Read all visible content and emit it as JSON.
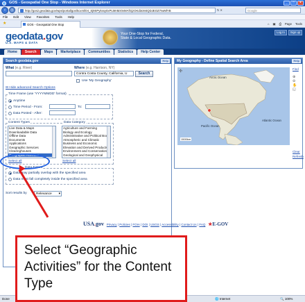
{
  "window": {
    "title": "GOS - Geospatial One Stop - Windows Internet Explorer"
  },
  "browser": {
    "url": "http://gos2.geodata.gov/wps/portal/gos/kcxml/04_Sj9SPykssy0xPLMnMz0vMAfGjzOKd3cM4QDJEOZ7IwMlYB",
    "search_placeholder": "Google",
    "menu": [
      "File",
      "Edit",
      "View",
      "Favorites",
      "Tools",
      "Help"
    ],
    "tab_title": "GOS - Geospatial One Stop",
    "tools": [
      "Page",
      "Tools"
    ]
  },
  "site": {
    "logo_main": "geodata",
    "logo_dot": ".",
    "logo_tld": "gov",
    "logo_sub": "U.S. MAPS & DATA",
    "tagline_1": "Your One-Stop for Federal,",
    "tagline_2": "State & Local Geographic Data.",
    "top_links": [
      "Log In",
      "Sign up"
    ],
    "nav_tabs": [
      {
        "label": "Home",
        "active": false
      },
      {
        "label": "Search",
        "active": true
      },
      {
        "label": "Maps",
        "active": false
      },
      {
        "label": "Marketplace",
        "active": false
      },
      {
        "label": "Communities",
        "active": false
      },
      {
        "label": "Statistics",
        "active": false
      },
      {
        "label": "Help Center",
        "active": false
      }
    ]
  },
  "search": {
    "panel_title": "Search geodata.gov",
    "help_label": "Help",
    "what_label": "What",
    "what_hint": "(e.g. River)",
    "where_label": "Where",
    "where_hint": "(e.g. Harrison, NY)",
    "where_value": "Contra Costa County, California, U",
    "search_button": "Search",
    "use_my_geography": "Use 'My Geography'",
    "hide_options": "Hide advanced Search Options",
    "time_frame_legend": "Time Frame (use 'YYYYMMDD' format)",
    "time_anytime": "Anytime",
    "time_period_from": "Time Period - From:",
    "time_to": "To:",
    "time_posted_after": "Data Posted - After:",
    "content_types_legend": "Content Types",
    "content_types": [
      "Live Data & Maps",
      "Downloadable Data",
      "Offline Data",
      "Documents",
      "Applications",
      "Geographic Services",
      "Clearinghouses",
      "Geographic Activities"
    ],
    "content_types_selected": "Geographic Activities",
    "select_all": "Select all",
    "data_category_legend": "Data Category",
    "data_categories": [
      "Agriculture and Farming",
      "Biology and Ecology",
      "Administrative and Political Boundaries",
      "Atmospheric and Climatic",
      "Business and Economic",
      "Elevation and Derived Products",
      "Environment and Conservation",
      "Geological and Geophysical"
    ],
    "select_all_2": "Select all",
    "overlap_legend": "Data Extent",
    "overlap_partial": "Data may partially overlap with the specified area",
    "overlap_full": "Data must fall completely inside the specified area",
    "sort_label": "Sort results by",
    "sort_value": "Relevance"
  },
  "map": {
    "panel_title": "My Geography - Define Spatial Search Area",
    "help_label": "Help",
    "arctic": "Arctic Ocean",
    "pacific": "Pacific Ocean",
    "atlantic": "Atlantic Ocean",
    "find": "Find",
    "clear": "Clear",
    "refresh": "Refresh",
    "scale": "1500km"
  },
  "footer": {
    "usa_1": "USA",
    "usa_2": "gov",
    "links": [
      "Privacy",
      "Policies",
      "FOIA",
      "DOI",
      "USGS",
      "Accessibility",
      "Contact Us",
      "FAQ"
    ],
    "egov": "E-GOV"
  },
  "status": {
    "left": "Done",
    "zone": "Internet",
    "zoom": "100%"
  },
  "callout": {
    "text": "Select “Geographic Activities” for the Content Type"
  },
  "colors": {
    "accent": "#d8282f",
    "nav": "#0e3d80",
    "selection": "#316ac5",
    "annotation": "#e01b1b"
  }
}
